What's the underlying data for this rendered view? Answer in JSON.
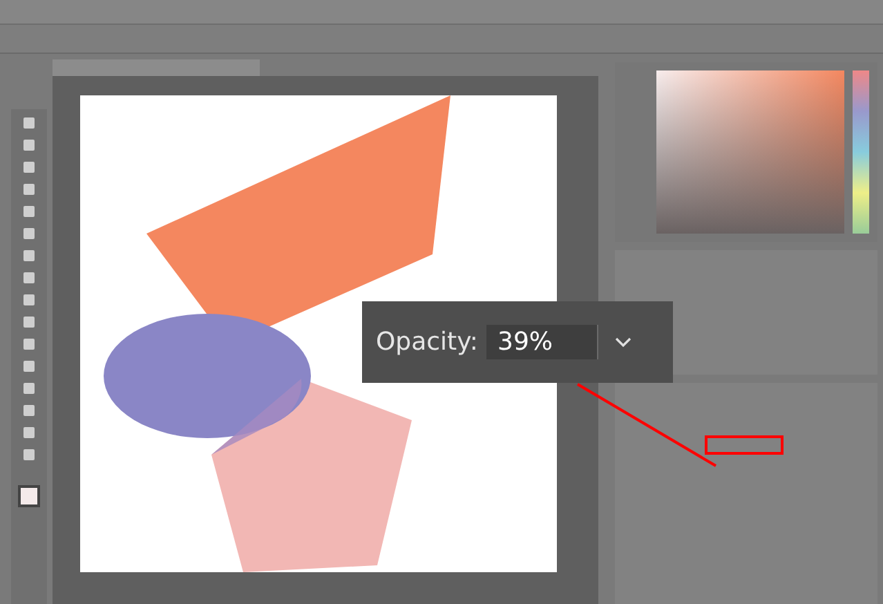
{
  "opacity_callout": {
    "label": "Opacity:",
    "value": "39%"
  }
}
